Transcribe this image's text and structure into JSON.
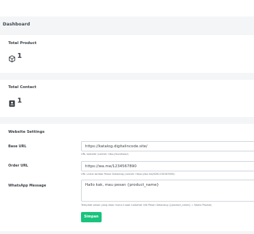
{
  "header": {
    "title": "Dashboard"
  },
  "stats": {
    "product": {
      "label": "Total Product",
      "value": "1",
      "icon": "cube-icon"
    },
    "contact": {
      "label": "Total Contact",
      "value": "1",
      "icon": "contact-card-icon"
    }
  },
  "settings": {
    "title": "Website Settings",
    "base_url": {
      "label": "Base URL",
      "value": "https://katalog.digitalincode.site/",
      "hint": "URL website (contoh: http://localhost/)"
    },
    "order_url": {
      "label": "Order URL",
      "value": "https://wa.me/1234567890",
      "hint": "URL untuk tombol Pesan Sekarang (contoh: https://wa.me/6281234567890)"
    },
    "wa_message": {
      "label": "WhatsApp Message",
      "value": "Hallo kak, mau pesan {product_name}",
      "hint": "Template pesan yang akan muncul saat customer klik Pesan Sekarang ({product_name} = Nama Produk)"
    },
    "save_label": "Simpan"
  },
  "colors": {
    "accent": "#19c37d",
    "background": "#f4f5f7",
    "card": "#ffffff"
  }
}
